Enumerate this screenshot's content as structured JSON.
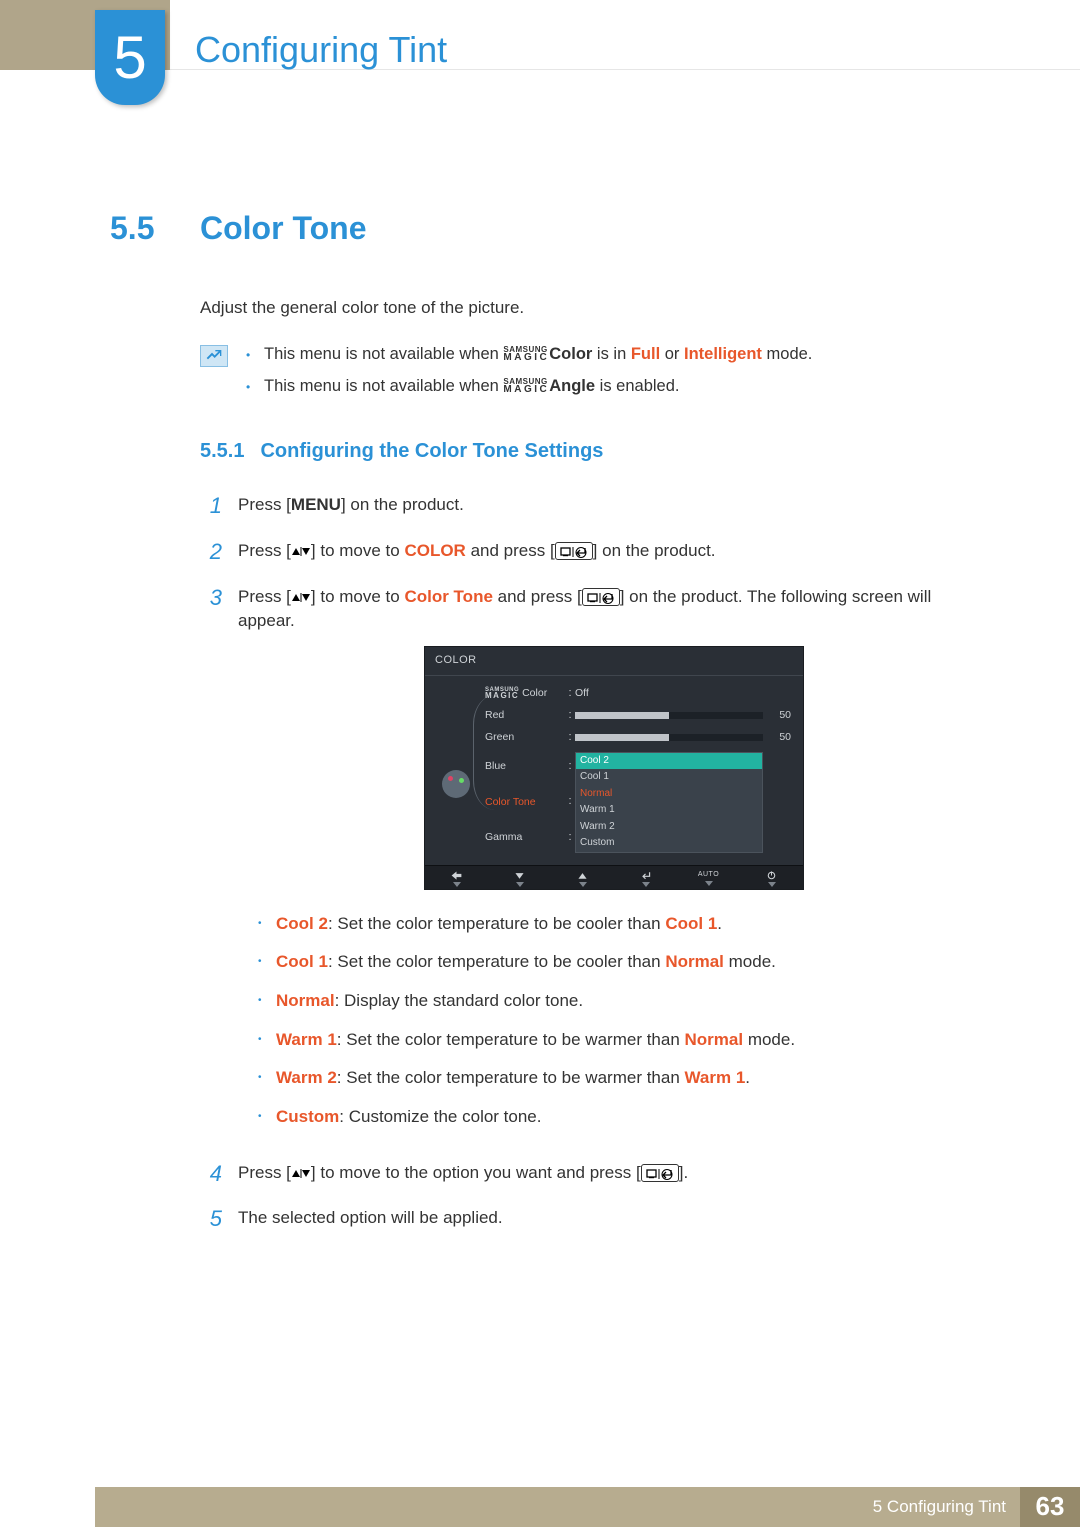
{
  "chapter": {
    "number": "5",
    "title": "Configuring Tint"
  },
  "section": {
    "number": "5.5",
    "title": "Color Tone"
  },
  "intro": "Adjust the general color tone of the picture.",
  "samsungMagic": {
    "top": "SAMSUNG",
    "bottom": "MAGIC"
  },
  "notes": {
    "n1": {
      "pre": "This menu is not available when ",
      "feature": "Color",
      "mid": " is in ",
      "m1": "Full",
      "or": " or ",
      "m2": "Intelligent",
      "post": " mode."
    },
    "n2": {
      "pre": "This menu is not available when ",
      "feature": "Angle",
      "post": " is enabled."
    }
  },
  "subsection": {
    "number": "5.5.1",
    "title": "Configuring the Color Tone Settings"
  },
  "steps": {
    "s1": {
      "num": "1",
      "a": "Press [",
      "menu": "MENU",
      "b": "] on the product."
    },
    "s2": {
      "num": "2",
      "a": "Press [",
      "b": "] to move to ",
      "color": "COLOR",
      "c": " and press [",
      "d": "] on the product."
    },
    "s3": {
      "num": "3",
      "a": "Press [",
      "b": "] to move to ",
      "ct": "Color Tone",
      "c": " and press [",
      "d": "] on the product. The following screen will appear."
    },
    "s4": {
      "num": "4",
      "a": "Press [",
      "b": "] to move to the option you want and press [",
      "c": "]."
    },
    "s5": {
      "num": "5",
      "a": "The selected option will be applied."
    }
  },
  "osd": {
    "title": "COLOR",
    "rows": {
      "magicColor": {
        "label": "Color",
        "value": "Off"
      },
      "red": {
        "label": "Red",
        "value": "50",
        "pct": 50
      },
      "green": {
        "label": "Green",
        "value": "50",
        "pct": 50
      },
      "blue": {
        "label": "Blue",
        "value": ""
      },
      "colorTone": {
        "label": "Color Tone"
      },
      "gamma": {
        "label": "Gamma"
      }
    },
    "dropdown": [
      "Cool 2",
      "Cool 1",
      "Normal",
      "Warm 1",
      "Warm 2",
      "Custom"
    ],
    "selected": "Cool 2",
    "footerAuto": "AUTO"
  },
  "tones": {
    "cool2": {
      "name": "Cool 2",
      "a": ": Set the color temperature to be cooler than ",
      "ref": "Cool 1",
      "b": "."
    },
    "cool1": {
      "name": "Cool 1",
      "a": ": Set the color temperature to be cooler than ",
      "ref": "Normal",
      "b": " mode."
    },
    "normal": {
      "name": "Normal",
      "a": ": Display the standard color tone."
    },
    "warm1": {
      "name": "Warm 1",
      "a": ": Set the color temperature to be warmer than ",
      "ref": "Normal",
      "b": " mode."
    },
    "warm2": {
      "name": "Warm 2",
      "a": ": Set the color temperature to be warmer than ",
      "ref": "Warm 1",
      "b": "."
    },
    "custom": {
      "name": "Custom",
      "a": ": Customize the color tone."
    }
  },
  "footer": {
    "chapter": "5 Configuring Tint",
    "page": "63"
  }
}
